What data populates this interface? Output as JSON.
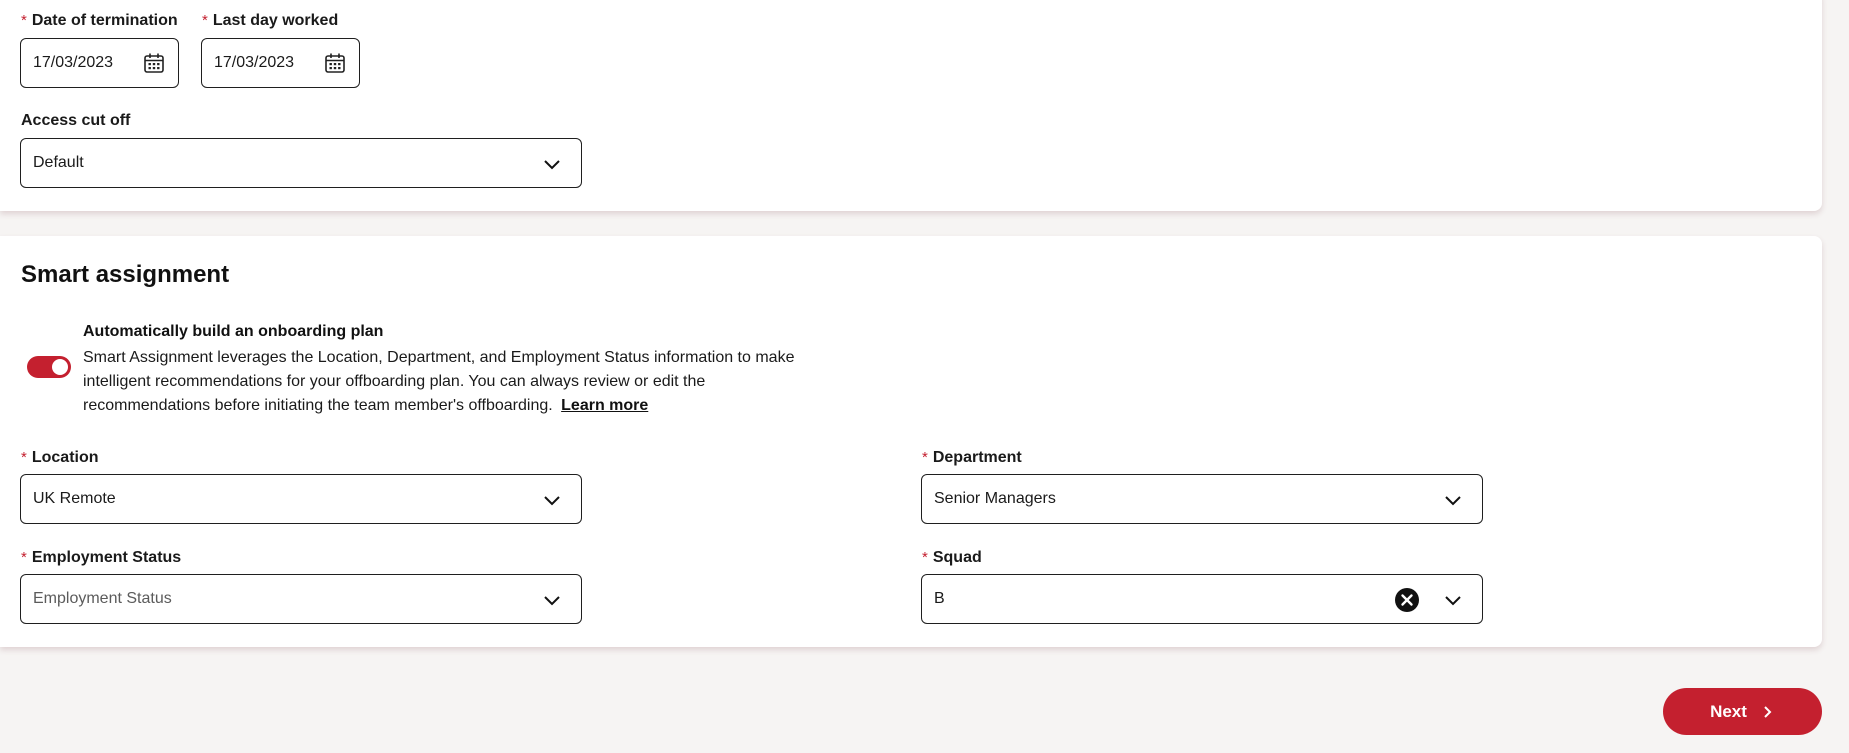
{
  "dates": {
    "termination_label": "Date of termination",
    "termination_value": "17/03/2023",
    "last_day_label": "Last day worked",
    "last_day_value": "17/03/2023",
    "required_marker": "*"
  },
  "access": {
    "label": "Access cut off",
    "value": "Default"
  },
  "smart": {
    "title": "Smart assignment",
    "toggle_on": true,
    "toggle_title": "Automatically build an onboarding plan",
    "toggle_description": "Smart Assignment leverages the Location, Department, and Employment Status information to make intelligent recommendations for your offboarding plan. You can always review or edit the recommendations before initiating the team member's offboarding.",
    "learn_more": "Learn more"
  },
  "fields": {
    "location_label": "Location",
    "location_value": "UK Remote",
    "department_label": "Department",
    "department_value": "Senior Managers",
    "employment_label": "Employment Status",
    "employment_placeholder": "Employment Status",
    "squad_label": "Squad",
    "squad_value": "B"
  },
  "footer": {
    "next_label": "Next"
  },
  "colors": {
    "accent": "#c4202f",
    "background": "#f6f4f3",
    "card": "#ffffff"
  },
  "icons": {
    "calendar": "calendar-icon",
    "chevron": "chevron-down-icon",
    "clear": "clear-icon",
    "next": "chevron-right-icon"
  }
}
